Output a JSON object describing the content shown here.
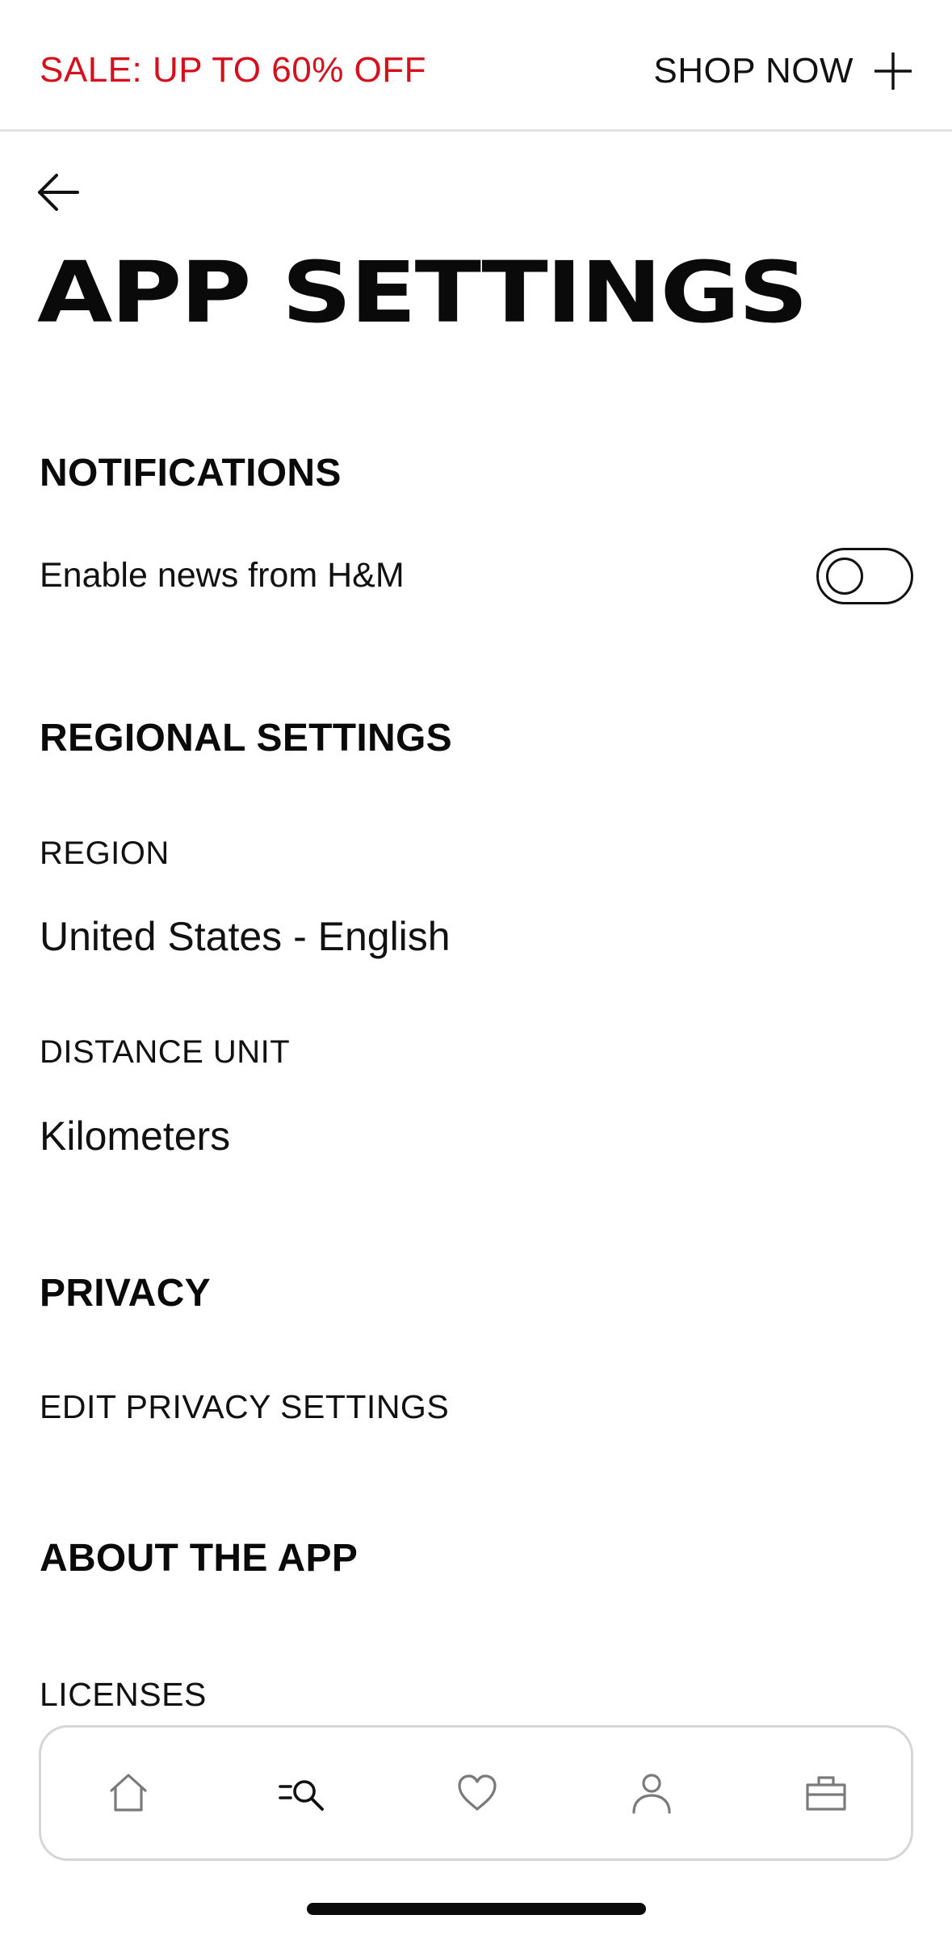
{
  "promo": {
    "text": "SALE: UP TO 60% OFF",
    "cta_label": "SHOP NOW",
    "text_color": "#d5101c"
  },
  "header": {
    "back_icon": "arrow-left-icon",
    "title": "APP SETTINGS"
  },
  "notifications": {
    "heading": "NOTIFICATIONS",
    "news_label": "Enable news from H&M",
    "news_enabled": false
  },
  "regional": {
    "heading": "REGIONAL SETTINGS",
    "region_label": "REGION",
    "region_value": "United States - English",
    "distance_label": "DISTANCE UNIT",
    "distance_value": "Kilometers"
  },
  "privacy": {
    "heading": "PRIVACY",
    "edit_link": "EDIT PRIVACY SETTINGS"
  },
  "about": {
    "heading": "ABOUT THE APP",
    "licenses_link": "LICENSES"
  },
  "bottom_nav": {
    "items": [
      {
        "icon": "home-icon",
        "active": false
      },
      {
        "icon": "menu-search-icon",
        "active": true
      },
      {
        "icon": "heart-icon",
        "active": false
      },
      {
        "icon": "person-icon",
        "active": false
      },
      {
        "icon": "shopping-bag-icon",
        "active": false
      }
    ]
  }
}
